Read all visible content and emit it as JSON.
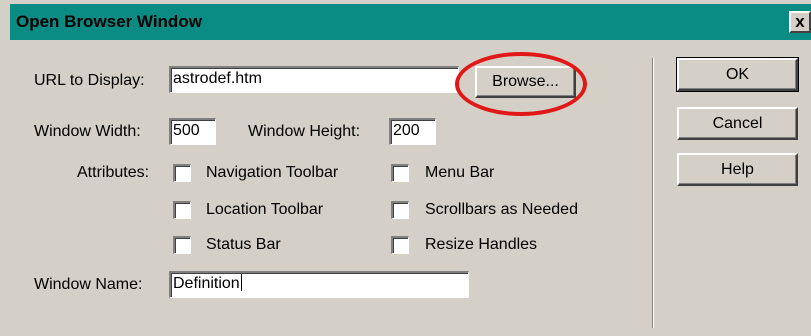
{
  "window": {
    "title": "Open Browser Window",
    "close_glyph": "x"
  },
  "form": {
    "url_label": "URL to Display:",
    "url_value": "astrodef.htm",
    "browse_label": "Browse...",
    "width_label": "Window Width:",
    "width_value": "500",
    "height_label": "Window Height:",
    "height_value": "200",
    "attributes_label": "Attributes:",
    "attributes": [
      {
        "label": "Navigation Toolbar",
        "checked": false
      },
      {
        "label": "Menu Bar",
        "checked": false
      },
      {
        "label": "Location Toolbar",
        "checked": false
      },
      {
        "label": "Scrollbars as Needed",
        "checked": false
      },
      {
        "label": "Status Bar",
        "checked": false
      },
      {
        "label": "Resize Handles",
        "checked": false
      }
    ],
    "name_label": "Window Name:",
    "name_value": "Definition"
  },
  "buttons": {
    "ok": "OK",
    "cancel": "Cancel",
    "help": "Help"
  },
  "annotation": {
    "circle_color": "#e01818"
  }
}
